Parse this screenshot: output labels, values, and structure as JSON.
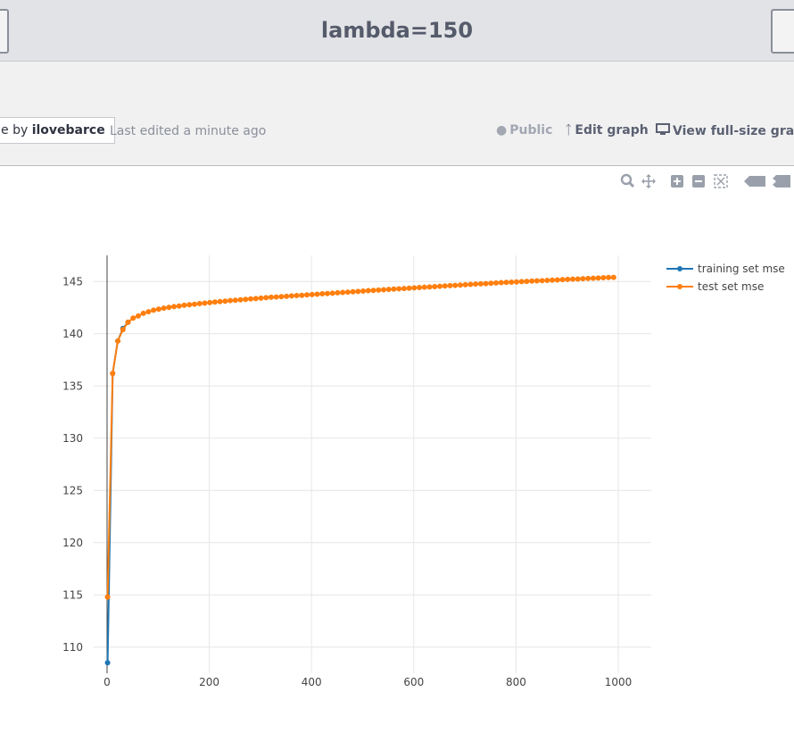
{
  "header": {
    "title": "lambda=150"
  },
  "meta": {
    "byline_prefix": "e by",
    "byline_user": "ilovebarce",
    "last_edited": "Last edited a minute ago",
    "public_label": "Public",
    "edit_label": "Edit graph",
    "view_label": "View full-size graph"
  },
  "modebar": {
    "icons": [
      "zoom-icon",
      "pan-icon",
      "zoom-in-icon",
      "zoom-out-icon",
      "autoscale-icon",
      "hover-closest-icon",
      "hover-compare-icon"
    ]
  },
  "chart_data": {
    "type": "line",
    "title": "",
    "xlabel": "",
    "ylabel": "",
    "xlim": [
      0,
      1000
    ],
    "ylim": [
      107.5,
      147.5
    ],
    "xticks": [
      0,
      200,
      400,
      600,
      800,
      1000
    ],
    "yticks": [
      110,
      115,
      120,
      125,
      130,
      135,
      140,
      145
    ],
    "grid": true,
    "legend_position": "top-right",
    "series": [
      {
        "name": "training set mse",
        "color": "#1f77b4",
        "points": [
          [
            1,
            108.5
          ],
          [
            11,
            136.2
          ],
          [
            21,
            139.3
          ],
          [
            31,
            140.5
          ],
          [
            41,
            141.1
          ]
        ]
      },
      {
        "name": "test set mse",
        "color": "#ff7f0e",
        "points": [
          [
            1,
            114.8
          ],
          [
            11,
            136.2
          ],
          [
            21,
            139.3
          ],
          [
            31,
            140.4
          ],
          [
            41,
            141.1
          ],
          [
            51,
            141.5
          ],
          [
            61,
            141.7
          ],
          [
            71,
            141.95
          ],
          [
            81,
            142.1
          ],
          [
            91,
            142.25
          ],
          [
            101,
            142.35
          ],
          [
            111,
            142.45
          ],
          [
            121,
            142.52
          ],
          [
            131,
            142.6
          ],
          [
            141,
            142.65
          ],
          [
            151,
            142.72
          ],
          [
            161,
            142.78
          ],
          [
            171,
            142.82
          ],
          [
            181,
            142.88
          ],
          [
            191,
            142.93
          ],
          [
            201,
            142.98
          ],
          [
            211,
            143.03
          ],
          [
            221,
            143.08
          ],
          [
            231,
            143.12
          ],
          [
            241,
            143.17
          ],
          [
            251,
            143.21
          ],
          [
            261,
            143.25
          ],
          [
            271,
            143.29
          ],
          [
            281,
            143.33
          ],
          [
            291,
            143.37
          ],
          [
            301,
            143.41
          ],
          [
            311,
            143.45
          ],
          [
            321,
            143.49
          ],
          [
            331,
            143.52
          ],
          [
            341,
            143.55
          ],
          [
            351,
            143.58
          ],
          [
            361,
            143.62
          ],
          [
            371,
            143.65
          ],
          [
            381,
            143.68
          ],
          [
            391,
            143.72
          ],
          [
            401,
            143.75
          ],
          [
            411,
            143.78
          ],
          [
            421,
            143.82
          ],
          [
            431,
            143.85
          ],
          [
            441,
            143.88
          ],
          [
            451,
            143.92
          ],
          [
            461,
            143.95
          ],
          [
            471,
            143.98
          ],
          [
            481,
            144.02
          ],
          [
            491,
            144.05
          ],
          [
            501,
            144.08
          ],
          [
            511,
            144.12
          ],
          [
            521,
            144.15
          ],
          [
            531,
            144.18
          ],
          [
            541,
            144.21
          ],
          [
            551,
            144.24
          ],
          [
            561,
            144.27
          ],
          [
            571,
            144.3
          ],
          [
            581,
            144.33
          ],
          [
            591,
            144.36
          ],
          [
            601,
            144.39
          ],
          [
            611,
            144.42
          ],
          [
            621,
            144.45
          ],
          [
            631,
            144.48
          ],
          [
            641,
            144.51
          ],
          [
            651,
            144.54
          ],
          [
            661,
            144.57
          ],
          [
            671,
            144.6
          ],
          [
            681,
            144.63
          ],
          [
            691,
            144.66
          ],
          [
            701,
            144.69
          ],
          [
            711,
            144.72
          ],
          [
            721,
            144.75
          ],
          [
            731,
            144.78
          ],
          [
            741,
            144.8
          ],
          [
            751,
            144.83
          ],
          [
            761,
            144.86
          ],
          [
            771,
            144.89
          ],
          [
            781,
            144.91
          ],
          [
            791,
            144.94
          ],
          [
            801,
            144.96
          ],
          [
            811,
            144.99
          ],
          [
            821,
            145.01
          ],
          [
            831,
            145.04
          ],
          [
            841,
            145.06
          ],
          [
            851,
            145.08
          ],
          [
            861,
            145.11
          ],
          [
            871,
            145.13
          ],
          [
            881,
            145.15
          ],
          [
            891,
            145.18
          ],
          [
            901,
            145.2
          ],
          [
            911,
            145.22
          ],
          [
            921,
            145.24
          ],
          [
            931,
            145.27
          ],
          [
            941,
            145.29
          ],
          [
            951,
            145.31
          ],
          [
            961,
            145.33
          ],
          [
            971,
            145.36
          ],
          [
            981,
            145.38
          ],
          [
            991,
            145.4
          ]
        ]
      }
    ]
  }
}
